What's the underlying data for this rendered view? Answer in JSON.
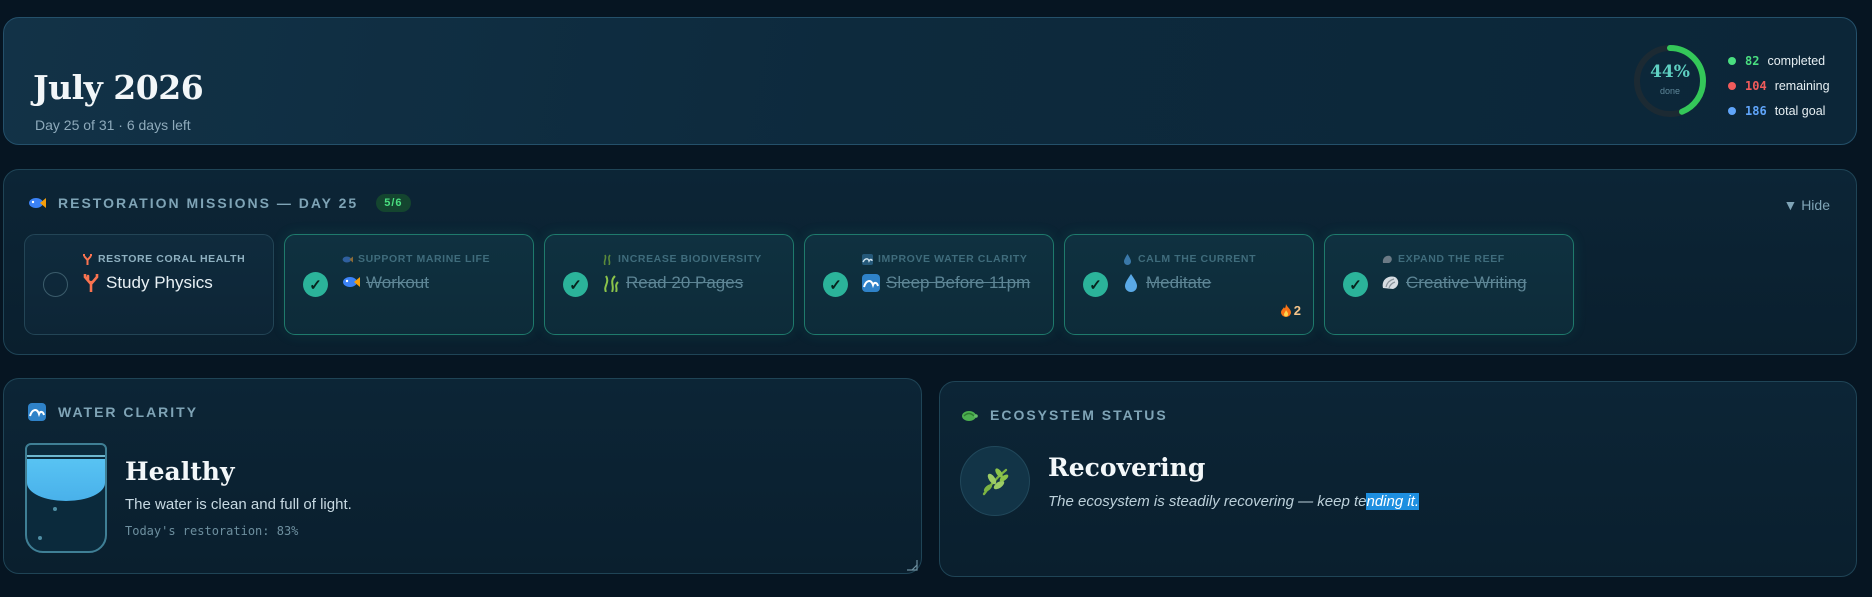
{
  "header": {
    "title": "July 2026",
    "subtitle": "Day 25 of 31 · 6 days left",
    "progress": {
      "percent_label": "44%",
      "percent_value": 44,
      "caption": "done"
    },
    "stats": [
      {
        "value": "82",
        "label": "completed",
        "color": "#4ade80"
      },
      {
        "value": "104",
        "label": "remaining",
        "color": "#f15b5b"
      },
      {
        "value": "186",
        "label": "total goal",
        "color": "#60a5fa"
      }
    ]
  },
  "missions": {
    "title": "RESTORATION MISSIONS — DAY 25",
    "count": "5/6",
    "toggle": "▼ Hide",
    "cards": [
      {
        "category": "RESTORE CORAL HEALTH",
        "task": "Study Physics",
        "done": false,
        "icon": "coral-icon"
      },
      {
        "category": "SUPPORT MARINE LIFE",
        "task": "Workout",
        "done": true,
        "icon": "fish-icon"
      },
      {
        "category": "INCREASE BIODIVERSITY",
        "task": "Read 20 Pages",
        "done": true,
        "icon": "seaweed-icon"
      },
      {
        "category": "IMPROVE WATER CLARITY",
        "task": "Sleep Before 11pm",
        "done": true,
        "icon": "wave-icon"
      },
      {
        "category": "CALM THE CURRENT",
        "task": "Meditate",
        "done": true,
        "icon": "droplet-icon",
        "streak": "2"
      },
      {
        "category": "EXPAND THE REEF",
        "task": "Creative Writing",
        "done": true,
        "icon": "shell-icon"
      }
    ],
    "check_glyph": "✓"
  },
  "water": {
    "title": "WATER CLARITY",
    "state": "Healthy",
    "description": "The water is clean and full of light.",
    "restoration": "Today's restoration: 83%",
    "restoration_value": 83
  },
  "ecosystem": {
    "title": "ECOSYSTEM STATUS",
    "state": "Recovering",
    "description_start": "The ecosystem is steadily recovering — keep te",
    "description_selected": "nding it."
  }
}
